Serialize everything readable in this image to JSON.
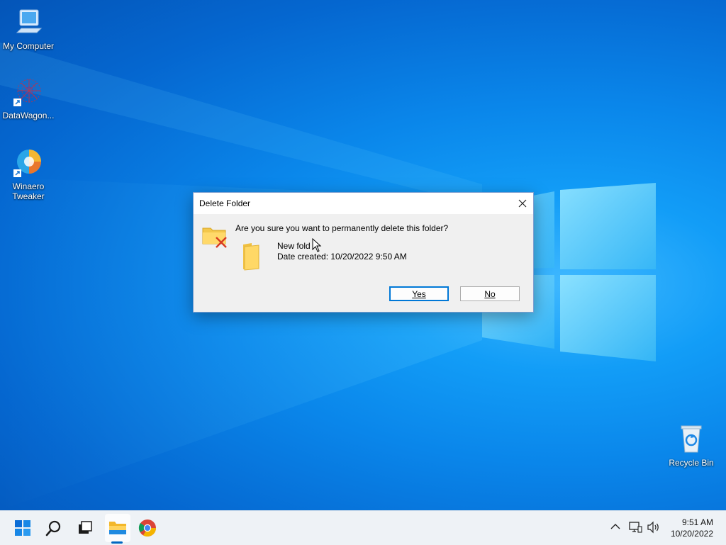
{
  "desktop": {
    "icons": [
      {
        "label": "My Computer"
      },
      {
        "label": "DataWagon..."
      },
      {
        "label_line1": "Winaero",
        "label_line2": "Tweaker"
      },
      {
        "label": "Recycle Bin"
      }
    ]
  },
  "dialog": {
    "title": "Delete Folder",
    "message": "Are you sure you want to permanently delete this folder?",
    "item_name": "New fold",
    "item_date": "Date created: 10/20/2022 9:50 AM",
    "yes_label": "Yes",
    "no_label": "No"
  },
  "taskbar": {
    "time": "9:51 AM",
    "date": "10/20/2022"
  },
  "colors": {
    "accent": "#0078d7",
    "wallpaper": "#0a86ea"
  }
}
